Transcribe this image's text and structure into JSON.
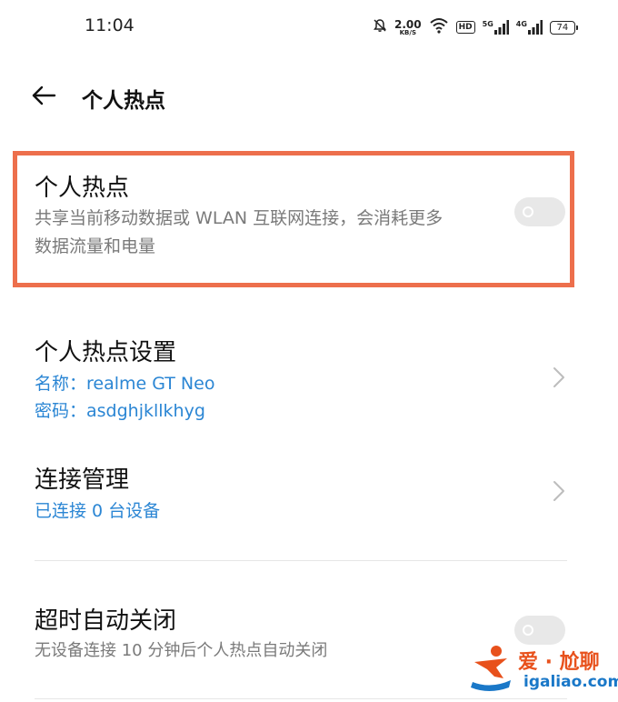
{
  "status": {
    "time": "11:04",
    "net_speed": "2.00",
    "net_speed_unit": "KB/S",
    "hd_label": "HD",
    "sim1_label": "5G",
    "sim2_label": "4G",
    "battery": "74"
  },
  "header": {
    "title": "个人热点"
  },
  "hotspot": {
    "title": "个人热点",
    "desc_line1": "共享当前移动数据或 WLAN 互联网连接，会消耗更多",
    "desc_line2": "数据流量和电量",
    "enabled": false
  },
  "settings": {
    "title": "个人热点设置",
    "name_line": "名称：realme GT Neo",
    "password_line": "密码：asdghjkllkhyg"
  },
  "connections": {
    "title": "连接管理",
    "status": "已连接 0 台设备"
  },
  "auto_off": {
    "title": "超时自动关闭",
    "desc": "无设备连接 10 分钟后个人热点自动关闭",
    "enabled": false
  },
  "watermark": {
    "brand": "爱 · 尬聊",
    "domain": "igaliao.com"
  },
  "colors": {
    "accent_blue": "#2b86d4",
    "highlight": "#ed6f4c",
    "toggle_off": "#e8e8e8"
  }
}
